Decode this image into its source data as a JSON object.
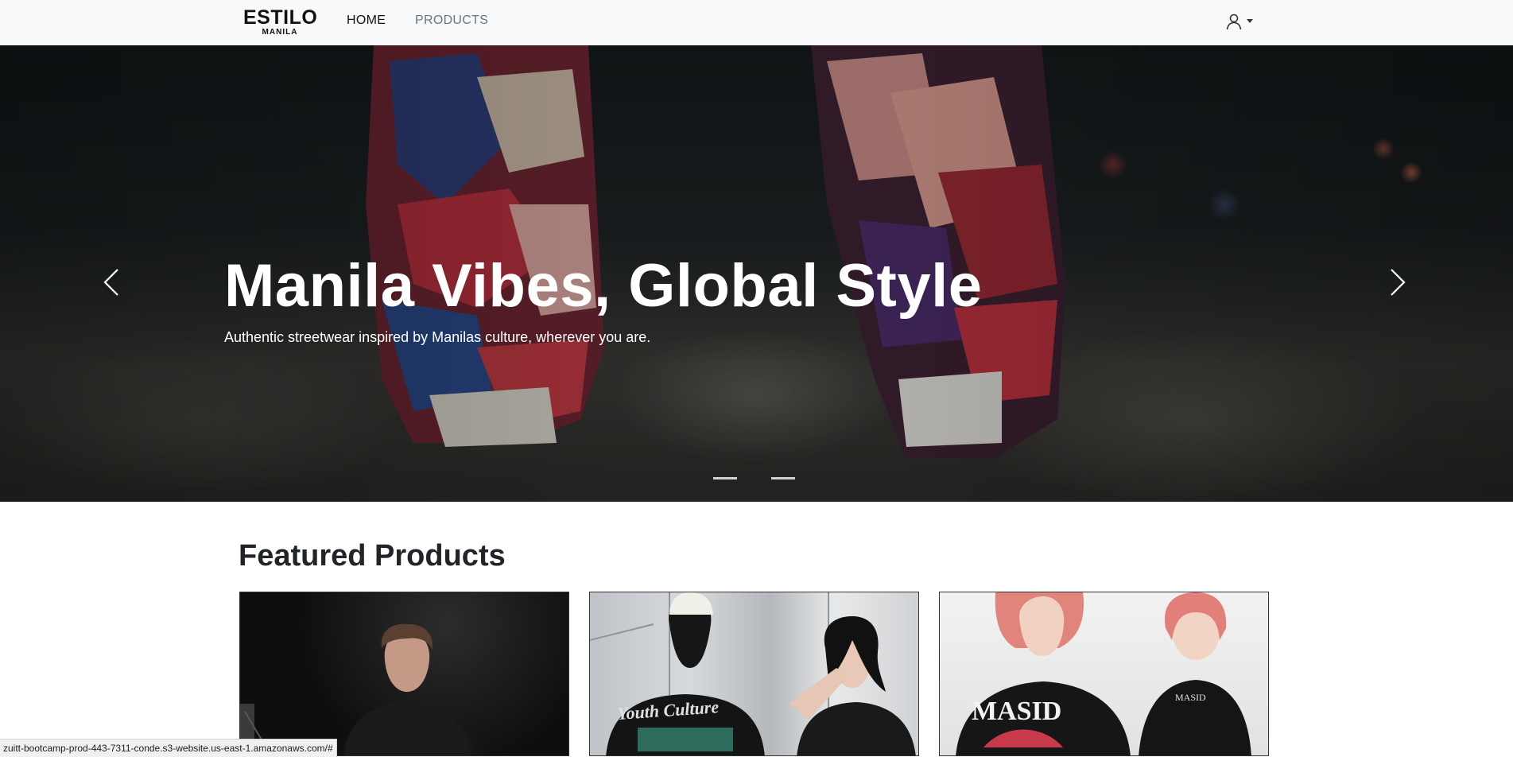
{
  "navbar": {
    "brand_main": "ESTILO",
    "brand_sub": "MANILA",
    "links": [
      {
        "label": "HOME",
        "active": true
      },
      {
        "label": "PRODUCTS",
        "active": false
      }
    ],
    "user_icon": "user-icon"
  },
  "hero": {
    "title": "Manila Vibes, Global Style",
    "subtitle": "Authentic streetwear inspired by Manilas culture, wherever you are.",
    "prev_icon": "chevron-left-icon",
    "next_icon": "chevron-right-icon",
    "slide_count": 2,
    "active_slide": 1
  },
  "featured": {
    "title": "Featured Products",
    "cards": [
      {
        "image": "product-image-model-black-tee",
        "print_text": ""
      },
      {
        "image": "product-image-youth-culture-tee",
        "print_text": "Youth Culture"
      },
      {
        "image": "product-image-masid-tee",
        "print_text": "MASID"
      }
    ]
  },
  "status_bar": {
    "url": "zuitt-bootcamp-prod-443-7311-conde.s3-website.us-east-1.amazonaws.com/#"
  },
  "colors": {
    "navbar_bg": "#f8f9fa",
    "text_dark": "#212529",
    "text_muted": "#6c757d",
    "hero_text": "#ffffff"
  }
}
